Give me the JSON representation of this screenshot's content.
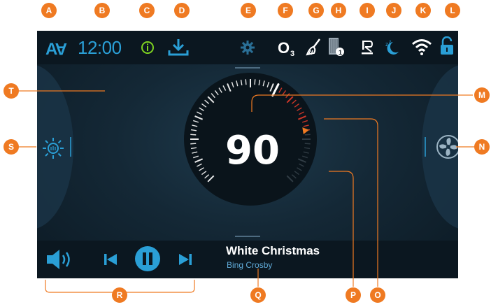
{
  "status_bar": {
    "time": "12:00",
    "ozone_label": "O",
    "ozone_subscript": "3",
    "icons": [
      "av-icon",
      "info-icon",
      "download-icon",
      "gear-icon",
      "ozone-icon",
      "cleaning-icon",
      "water-tank-icon",
      "ionizer-icon",
      "night-mode-icon",
      "wifi-icon",
      "lock-icon"
    ]
  },
  "dial": {
    "value": "90"
  },
  "media": {
    "title": "White Christmas",
    "artist": "Bing Crosby"
  },
  "colors": {
    "accent": "#2a9fd6",
    "callout": "#ef7a22",
    "warning_ticks": "#e03a2a"
  },
  "callouts": {
    "a": "A",
    "b": "B",
    "c": "C",
    "d": "D",
    "e": "E",
    "f": "F",
    "g": "G",
    "h": "H",
    "i": "I",
    "j": "J",
    "k": "K",
    "l": "L",
    "m": "M",
    "n": "N",
    "o": "O",
    "p": "P",
    "q": "Q",
    "r": "R",
    "s": "S",
    "t": "T"
  }
}
